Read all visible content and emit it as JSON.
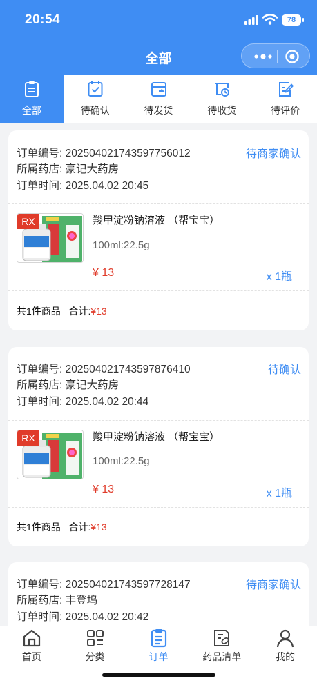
{
  "status_bar": {
    "time": "20:54",
    "battery": "78"
  },
  "nav": {
    "title": "全部"
  },
  "tabs": [
    {
      "label": "全部",
      "icon": "all-orders-icon",
      "active": true
    },
    {
      "label": "待确认",
      "icon": "checklist-icon",
      "active": false
    },
    {
      "label": "待发货",
      "icon": "shipping-box-icon",
      "active": false
    },
    {
      "label": "待收货",
      "icon": "delivery-clock-icon",
      "active": false
    },
    {
      "label": "待评价",
      "icon": "review-pencil-icon",
      "active": false
    }
  ],
  "orders": [
    {
      "order_no_label": "订单编号:",
      "order_no": "20250402174359775601​2",
      "pharmacy_label": "所属药店:",
      "pharmacy": "豪记大药房",
      "time_label": "订单时间:",
      "time": "2025.04.02 20:45",
      "status": "待商家确认",
      "product": {
        "badge": "RX",
        "name": "羧甲淀粉钠溶液 （帮宝宝）",
        "spec": "100ml:22.5g",
        "price": "¥ 13",
        "qty": "x 1瓶"
      },
      "summary_count": "共1件商品",
      "summary_total_label": "合计:",
      "summary_total": "¥13"
    },
    {
      "order_no_label": "订单编号:",
      "order_no": "20250402174359787641​0",
      "pharmacy_label": "所属药店:",
      "pharmacy": "豪记大药房",
      "time_label": "订单时间:",
      "time": "2025.04.02 20:44",
      "status": "待确认",
      "product": {
        "badge": "RX",
        "name": "羧甲淀粉钠溶液 （帮宝宝）",
        "spec": "100ml:22.5g",
        "price": "¥ 13",
        "qty": "x 1瓶"
      },
      "summary_count": "共1件商品",
      "summary_total_label": "合计:",
      "summary_total": "¥13"
    },
    {
      "order_no_label": "订单编号:",
      "order_no": "20250402174359772814​7",
      "pharmacy_label": "所属药店:",
      "pharmacy": "丰登坞",
      "time_label": "订单时间:",
      "time": "2025.04.02 20:42",
      "status": "待商家确认"
    }
  ],
  "bottom_nav": [
    {
      "label": "首页",
      "icon": "home-icon",
      "active": false
    },
    {
      "label": "分类",
      "icon": "category-grid-icon",
      "active": false
    },
    {
      "label": "订单",
      "icon": "order-clipboard-icon",
      "active": true
    },
    {
      "label": "药品清单",
      "icon": "medicine-list-icon",
      "active": false
    },
    {
      "label": "我的",
      "icon": "user-profile-icon",
      "active": false
    }
  ],
  "colors": {
    "primary": "#3f8df3",
    "price": "#e03b2a",
    "background": "#f2f3f5"
  }
}
